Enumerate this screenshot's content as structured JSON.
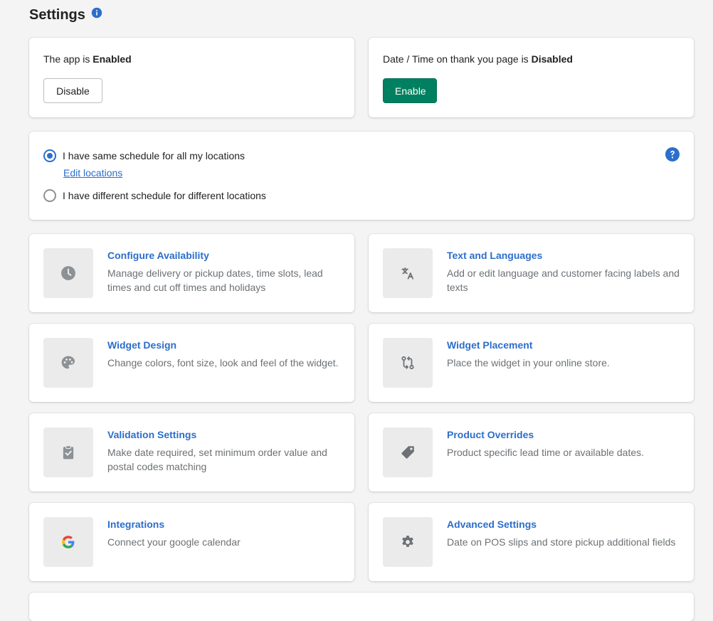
{
  "header": {
    "title": "Settings",
    "info_icon": "info-icon"
  },
  "app_status": {
    "prefix": "The app is ",
    "state": "Enabled",
    "button_label": "Disable"
  },
  "thankyou_status": {
    "prefix": "Date / Time on thank you page is ",
    "state": "Disabled",
    "button_label": "Enable"
  },
  "schedule": {
    "option_same": "I have same schedule for all my locations",
    "option_same_checked": true,
    "edit_link": "Edit locations",
    "option_different": "I have different schedule for different locations",
    "option_different_checked": false,
    "help_icon": "question-circle-icon"
  },
  "tiles": [
    {
      "title": "Configure Availability",
      "description": "Manage delivery or pickup dates, time slots, lead times and cut off times and holidays",
      "icon": "clock-icon"
    },
    {
      "title": "Text and Languages",
      "description": "Add or edit language and customer facing labels and texts",
      "icon": "translate-icon"
    },
    {
      "title": "Widget Design",
      "description": "Change colors, font size, look and feel of the widget.",
      "icon": "palette-icon"
    },
    {
      "title": "Widget Placement",
      "description": "Place the widget in your online store.",
      "icon": "swap-arrows-icon"
    },
    {
      "title": "Validation Settings",
      "description": "Make date required, set minimum order value and postal codes matching",
      "icon": "clipboard-check-icon"
    },
    {
      "title": "Product Overrides",
      "description": "Product specific lead time or available dates.",
      "icon": "tag-icon"
    },
    {
      "title": "Integrations",
      "description": "Connect your google calendar",
      "icon": "google-icon"
    },
    {
      "title": "Advanced Settings",
      "description": "Date on POS slips and store pickup additional fields",
      "icon": "gear-icon"
    }
  ],
  "colors": {
    "primary": "#008060",
    "link": "#2c6ecb",
    "icon_gray": "#8c9196",
    "background": "#f4f4f4"
  }
}
